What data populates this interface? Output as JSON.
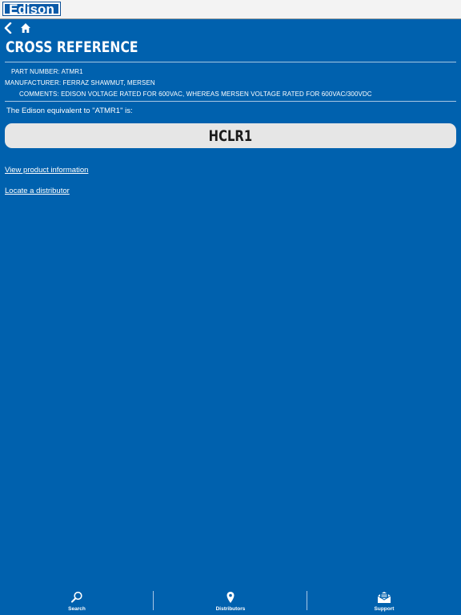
{
  "header": {
    "logo_text": "Edison"
  },
  "nav": {
    "back_icon": "chevron-left-icon",
    "home_icon": "home-icon"
  },
  "page": {
    "title": "CROSS REFERENCE",
    "part_number": "PART NUMBER: ATMR1",
    "manufacturer": "MANUFACTURER: FERRAZ SHAWMUT, MERSEN",
    "comments": "COMMENTS: EDISON VOLTAGE RATED FOR 600VAC, WHEREAS MERSEN VOLTAGE RATED FOR 600VAC/300VDC",
    "equivalent_text": "The Edison equivalent to \"ATMR1\" is:",
    "result": "HCLR1",
    "link_product_info": "View product information",
    "link_distributor": "Locate a distributor"
  },
  "tabbar": {
    "tabs": [
      {
        "label": "Search",
        "icon": "search-icon"
      },
      {
        "label": "Distributors",
        "icon": "map-pin-icon"
      },
      {
        "label": "Support",
        "icon": "envelope-icon"
      }
    ]
  },
  "colors": {
    "background": "#0061ae",
    "topbar": "#f3f3f3",
    "result_box": "#e6e6e6"
  }
}
